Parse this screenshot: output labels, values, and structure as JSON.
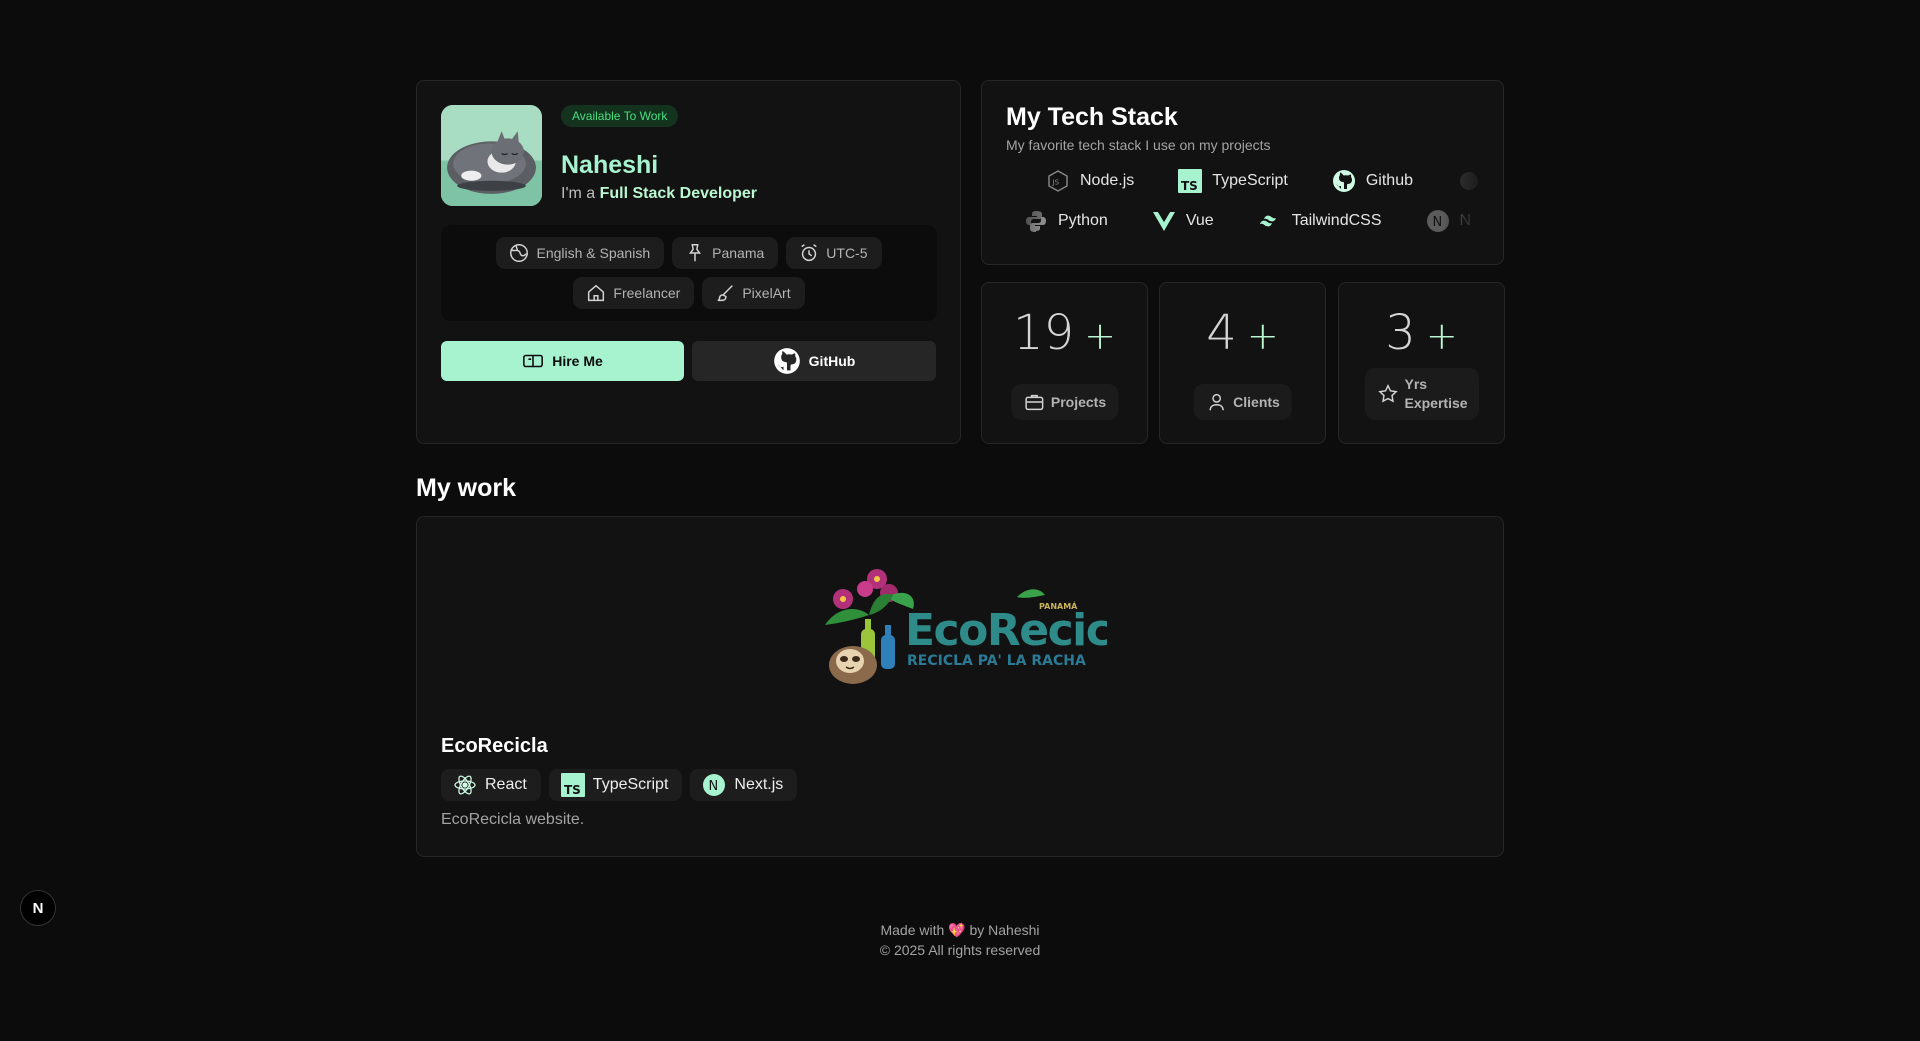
{
  "profile": {
    "availability": "Available To Work",
    "name": "Naheshi",
    "role_prefix": "I'm a",
    "role": "Full Stack Developer",
    "tags": [
      {
        "label": "English & Spanish",
        "icon": "globe-icon"
      },
      {
        "label": "Panama",
        "icon": "pin-icon"
      },
      {
        "label": "UTC-5",
        "icon": "alarm-clock-icon"
      },
      {
        "label": "Freelancer",
        "icon": "home-icon"
      },
      {
        "label": "PixelArt",
        "icon": "brush-icon"
      }
    ],
    "hire_label": "Hire Me",
    "github_label": "GitHub"
  },
  "stack": {
    "title": "My Tech Stack",
    "subtitle": "My favorite tech stack I use on my projects",
    "row1": [
      {
        "label": "Node.js",
        "icon": "nodejs-icon"
      },
      {
        "label": "TypeScript",
        "icon": "typescript-icon"
      },
      {
        "label": "Github",
        "icon": "github-icon"
      }
    ],
    "row2": [
      {
        "label": "Python",
        "icon": "python-icon"
      },
      {
        "label": "Vue",
        "icon": "vue-icon"
      },
      {
        "label": "TailwindCSS",
        "icon": "tailwind-icon"
      },
      {
        "label": "N",
        "icon": "nextjs-icon"
      }
    ]
  },
  "stats": [
    {
      "value": "19",
      "suffix": "+",
      "label": "Projects",
      "icon": "briefcase-icon"
    },
    {
      "value": "4",
      "suffix": "+",
      "label": "Clients",
      "icon": "user-icon"
    },
    {
      "value": "3",
      "suffix": "+",
      "label": "Yrs Expertise",
      "icon": "star-icon"
    }
  ],
  "work": {
    "section_title": "My work",
    "project": {
      "title": "EcoRecicla",
      "description": "EcoRecicla website.",
      "logo_text": "EcoRecicla",
      "logo_tagline": "RECICLA PA' LA RACHA",
      "logo_country": "PANAMÁ",
      "tags": [
        {
          "label": "React",
          "icon": "react-icon"
        },
        {
          "label": "TypeScript",
          "icon": "typescript-icon"
        },
        {
          "label": "Next.js",
          "icon": "nextjs-icon"
        }
      ]
    }
  },
  "footer": {
    "made_with": "Made with",
    "heart": "💖",
    "by": "by Naheshi",
    "copyright": "© 2025 All rights reserved"
  },
  "next_badge": "N",
  "colors": {
    "accent": "#a7f3d0",
    "available_bg": "#14331f",
    "available_text": "#4ade80",
    "background": "#0c0c0c",
    "card": "#121212"
  }
}
